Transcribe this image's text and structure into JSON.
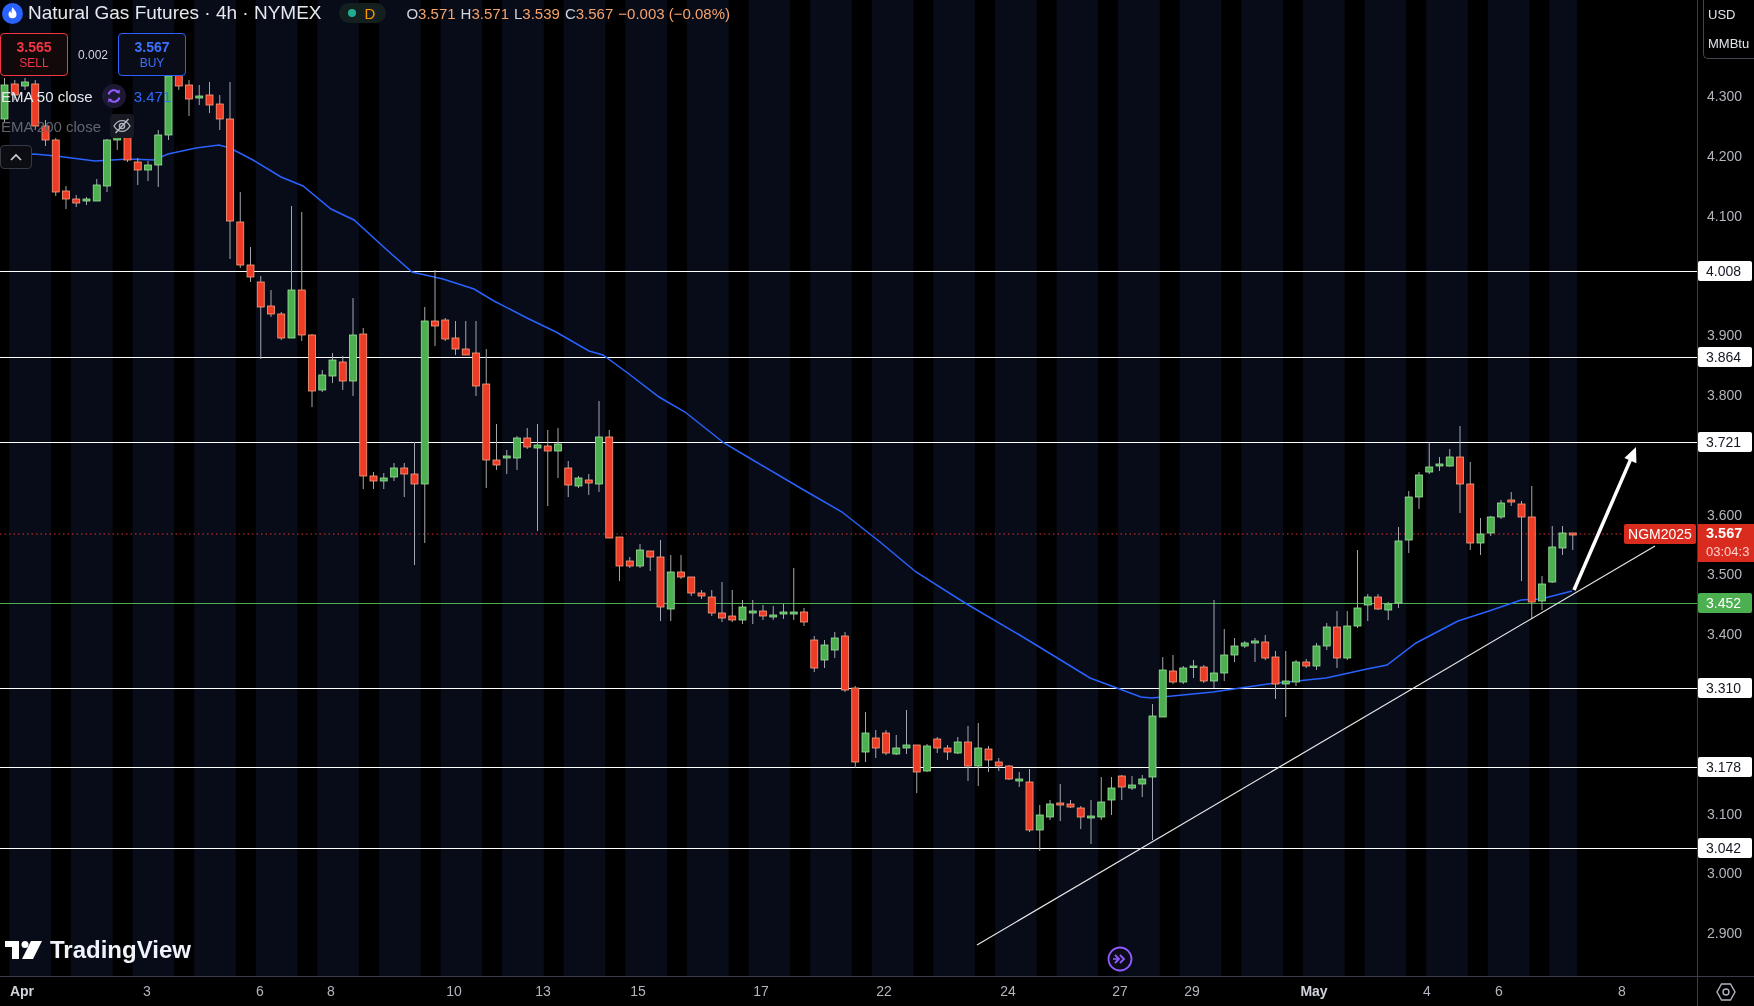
{
  "header": {
    "title": "Natural Gas Futures · 4h · NYMEX",
    "market_status": {
      "label": "D",
      "open": true
    },
    "ohlc": [
      {
        "key": "O",
        "value": "3.571"
      },
      {
        "key": "H",
        "value": "3.571"
      },
      {
        "key": "L",
        "value": "3.539"
      },
      {
        "key": "C",
        "value": "3.567"
      }
    ],
    "change": "−0.003 (−0.08%)"
  },
  "trade": {
    "sell": {
      "price": "3.565",
      "label": "SELL"
    },
    "spread": "0.002",
    "buy": {
      "price": "3.567",
      "label": "BUY"
    }
  },
  "indicators": [
    {
      "label": "EMA 50 close",
      "value": "3.471",
      "hidden": false
    },
    {
      "label": "EMA 200 close",
      "hidden": true
    }
  ],
  "price_axis": {
    "currency": "USD",
    "unit": "MMBtu",
    "ticks": [
      "4.300",
      "4.200",
      "4.100",
      "3.900",
      "3.800",
      "3.600",
      "3.500",
      "3.400",
      "3.100",
      "3.000",
      "2.900"
    ]
  },
  "levels": [
    {
      "price": "4.008",
      "color": "#ffffff"
    },
    {
      "price": "3.864",
      "color": "#ffffff"
    },
    {
      "price": "3.721",
      "color": "#ffffff"
    },
    {
      "price": "3.452",
      "color": "#4caf50"
    },
    {
      "price": "3.310",
      "color": "#ffffff"
    },
    {
      "price": "3.178",
      "color": "#ffffff"
    },
    {
      "price": "3.042",
      "color": "#ffffff"
    }
  ],
  "current_price": {
    "symbol": "NGM2025",
    "price": "3.567",
    "countdown": "03:04:3"
  },
  "time_axis": [
    {
      "label": "Apr",
      "kind": "month"
    },
    {
      "label": "3",
      "kind": "day"
    },
    {
      "label": "6",
      "kind": "day"
    },
    {
      "label": "8",
      "kind": "day"
    },
    {
      "label": "10",
      "kind": "day"
    },
    {
      "label": "13",
      "kind": "day"
    },
    {
      "label": "15",
      "kind": "day"
    },
    {
      "label": "17",
      "kind": "day"
    },
    {
      "label": "22",
      "kind": "day"
    },
    {
      "label": "24",
      "kind": "day"
    },
    {
      "label": "27",
      "kind": "day"
    },
    {
      "label": "29",
      "kind": "day"
    },
    {
      "label": "May",
      "kind": "month"
    },
    {
      "label": "4",
      "kind": "day"
    },
    {
      "label": "6",
      "kind": "day"
    },
    {
      "label": "8",
      "kind": "day"
    }
  ],
  "branding": {
    "name": "TradingView"
  }
}
